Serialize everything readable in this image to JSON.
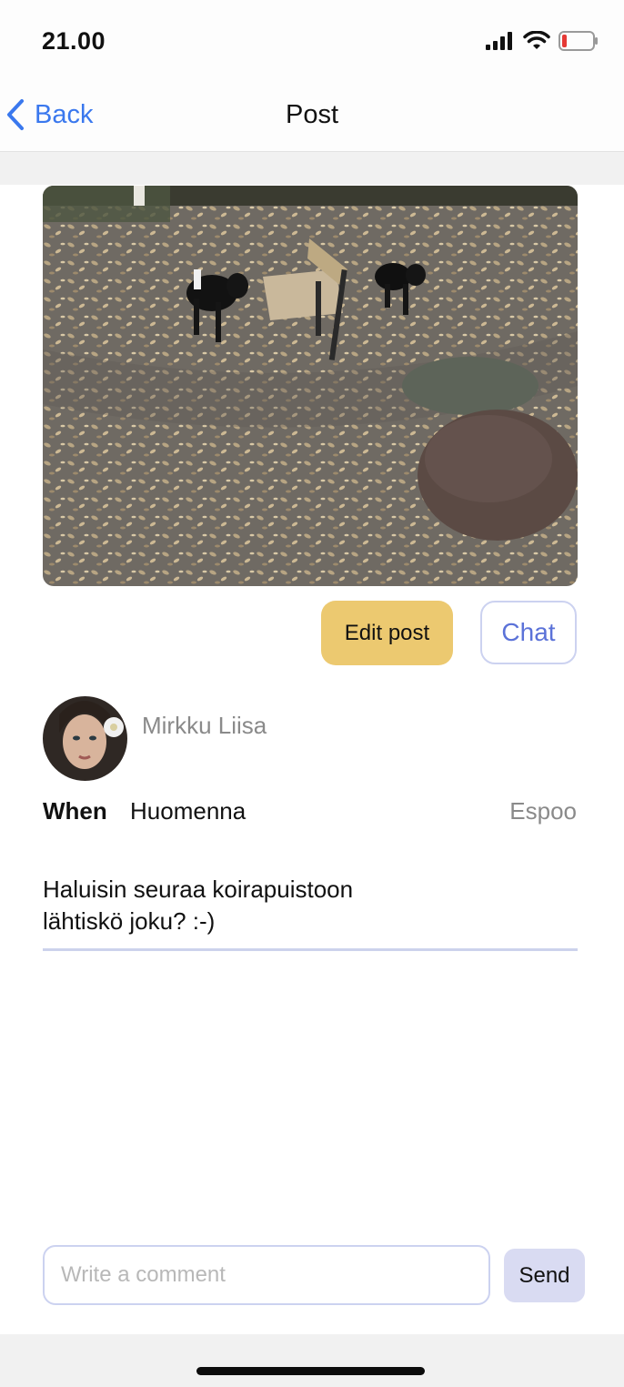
{
  "status_bar": {
    "time": "21.00",
    "icons": [
      "signal-icon",
      "wifi-icon",
      "battery-low-icon"
    ],
    "battery_color": "#e53935"
  },
  "nav": {
    "back_label": "Back",
    "title": "Post",
    "accent": "#3a78ee"
  },
  "post": {
    "image_description_icon": "photo-dog-park",
    "edit_label": "Edit post",
    "chat_label": "Chat",
    "author": "Mirkku Liisa",
    "when_label": "When",
    "when_value": "Huomenna",
    "location": "Espoo",
    "message": "Haluisin seuraa koirapuistoon\nlähtiskö joku? :-)",
    "edit_color": "#ecc970",
    "chat_color": "#5b72d8"
  },
  "comment": {
    "placeholder": "Write a comment",
    "value": "",
    "send_label": "Send",
    "send_color": "#d9dbf2"
  }
}
